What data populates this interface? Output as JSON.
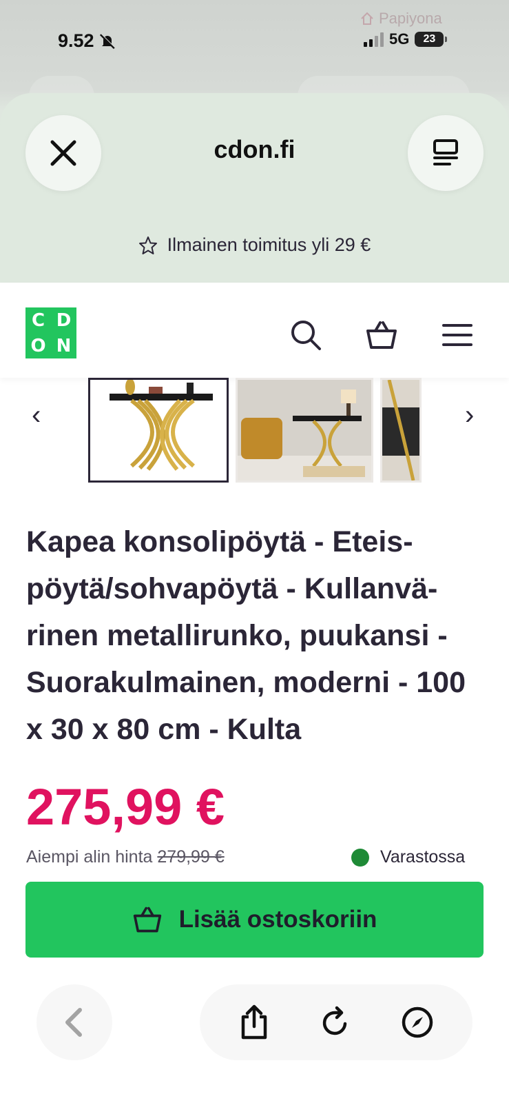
{
  "status_bar": {
    "time": "9.52",
    "network": "5G",
    "battery": "23",
    "watermark": "Papiyona"
  },
  "browser": {
    "domain": "cdon.fi"
  },
  "promo": {
    "shipping_text": "Ilmainen toimitus yli 29 €"
  },
  "site": {
    "logo_letters": [
      "C",
      "D",
      "O",
      "N"
    ]
  },
  "gallery": {
    "prev_arrow": "‹",
    "next_arrow": "›"
  },
  "product": {
    "title": "Kapea konsolipöytä - Eteis-pöytä/sohvapöytä - Kullanvä-rinen metallirunko, puukansi - Suorakulmainen, moderni - 100 x 30 x 80 cm - Kulta",
    "price": "275,99 €",
    "previous_price_label": "Aiempi alin hinta",
    "previous_price": "279,99 €",
    "stock_status": "Varastossa",
    "add_to_cart_label": "Lisää ostoskoriin"
  },
  "colors": {
    "brand_green": "#22c55e",
    "price_pink": "#e0125f",
    "stock_green": "#1e8a36"
  }
}
